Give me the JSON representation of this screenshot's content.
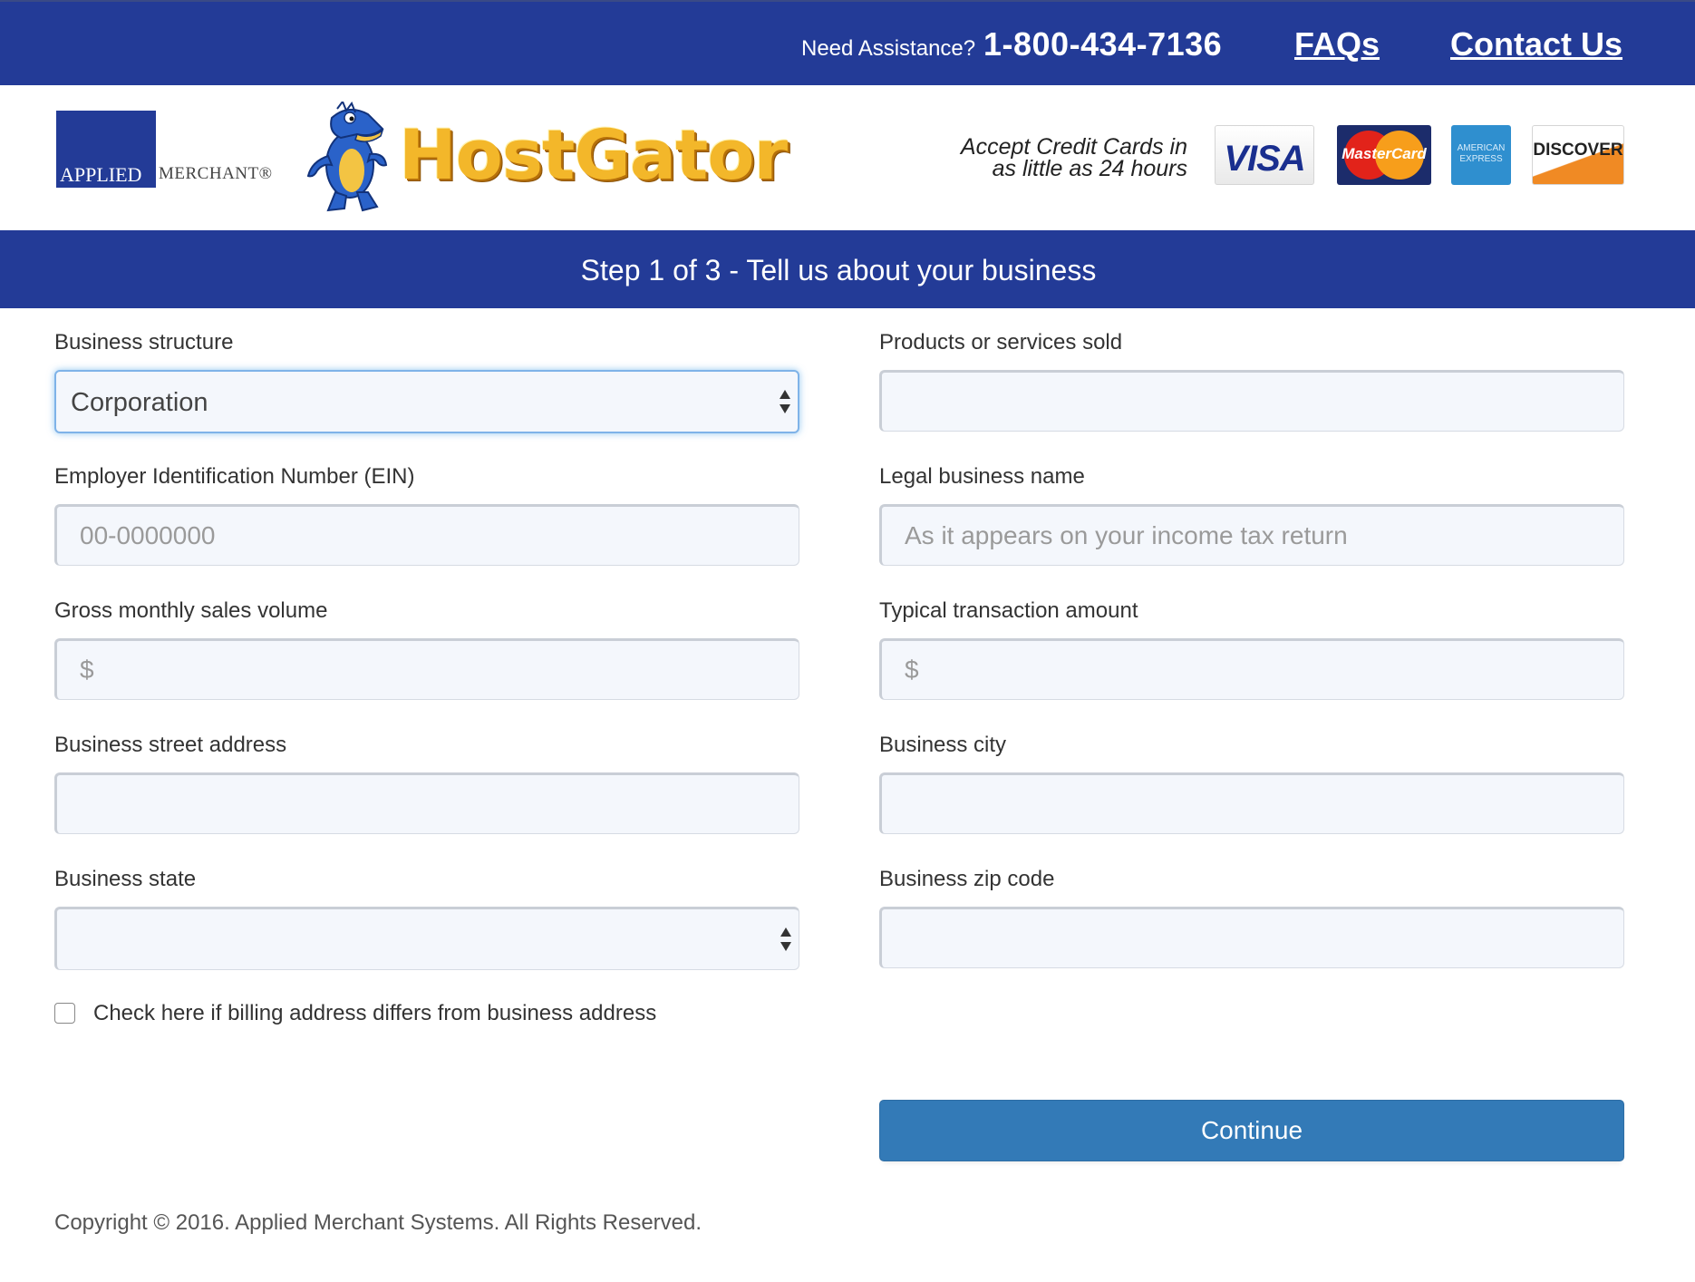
{
  "topbar": {
    "assist_label": "Need Assistance?",
    "phone": "1-800-434-7136",
    "faqs": "FAQs",
    "contact": "Contact Us"
  },
  "brand": {
    "am_applied": "APPLIED",
    "am_merchant": "MERCHANT®",
    "hostgator": "HostGator",
    "accept_line1": "Accept Credit Cards in",
    "accept_line2": "as little as 24 hours",
    "cards": {
      "visa": "VISA",
      "mastercard": "MasterCard",
      "amex": "AMERICAN EXPRESS",
      "discover": "DISCOVER"
    }
  },
  "step": {
    "title": "Step 1 of 3 - Tell us about your business"
  },
  "form": {
    "business_structure": {
      "label": "Business structure",
      "value": "Corporation"
    },
    "products": {
      "label": "Products or services sold",
      "value": "",
      "placeholder": ""
    },
    "ein": {
      "label": "Employer Identification Number (EIN)",
      "value": "",
      "placeholder": "00-0000000"
    },
    "legal_name": {
      "label": "Legal business name",
      "value": "",
      "placeholder": "As it appears on your income tax return"
    },
    "gross_monthly": {
      "label": "Gross monthly sales volume",
      "value": "",
      "placeholder": "$"
    },
    "typical_amount": {
      "label": "Typical transaction amount",
      "value": "",
      "placeholder": "$"
    },
    "street": {
      "label": "Business street address",
      "value": "",
      "placeholder": ""
    },
    "city": {
      "label": "Business city",
      "value": "",
      "placeholder": ""
    },
    "state": {
      "label": "Business state",
      "value": ""
    },
    "zip": {
      "label": "Business zip code",
      "value": "",
      "placeholder": ""
    },
    "billing_check_label": "Check here if billing address differs from business address",
    "continue": "Continue"
  },
  "footer": {
    "copyright": "Copyright © 2016. Applied Merchant Systems. All Rights Reserved."
  },
  "colors": {
    "brand_navy": "#233b97",
    "hostgator_gold": "#f3b72a",
    "button_blue": "#337ab7"
  },
  "icons": {
    "select_arrows": "updown-arrows-icon"
  }
}
